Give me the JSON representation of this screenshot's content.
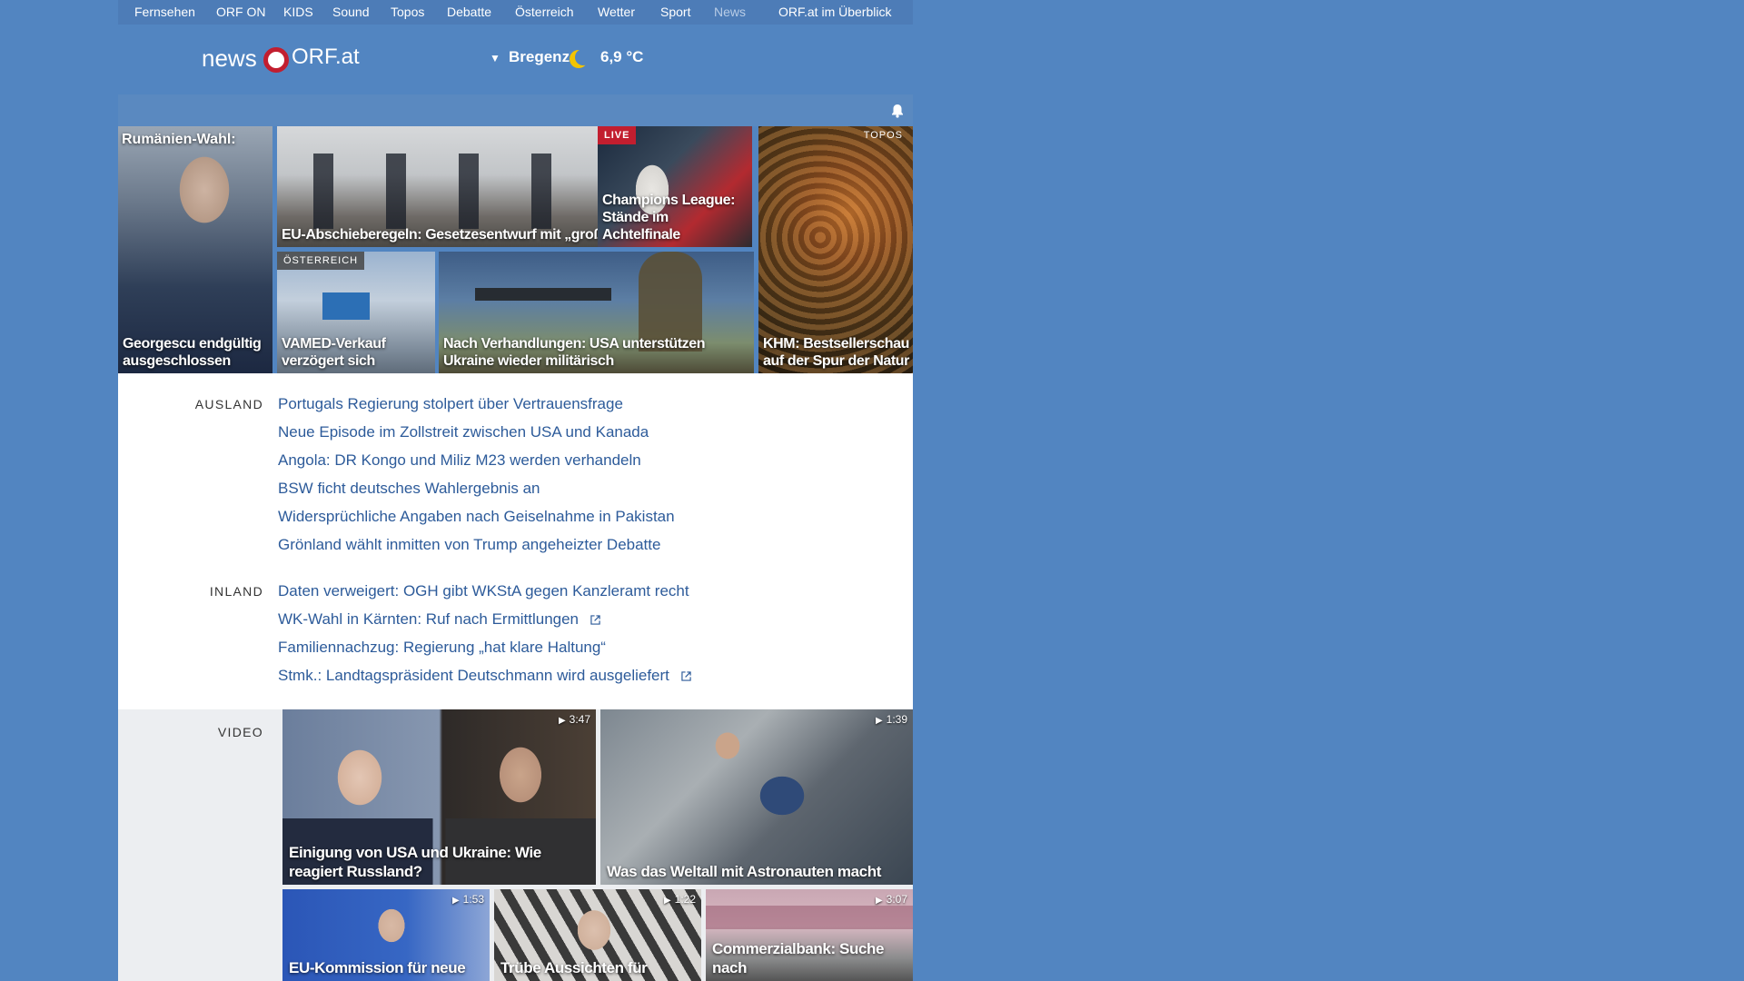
{
  "topnav": {
    "items": [
      "Fernsehen",
      "ORF ON",
      "KIDS",
      "Sound",
      "Topos",
      "Debatte",
      "Österreich",
      "Wetter",
      "Sport",
      "News",
      "ORF.at im Überblick"
    ]
  },
  "header": {
    "logo_news": "news",
    "logo_orf": "ORF.at",
    "weather_city": "Bregenz",
    "weather_temp": "6,9 °C",
    "weather_icon": "moon-icon"
  },
  "tiles": [
    {
      "title": "Rumänien-Wahl:",
      "caption": "Georgescu endgültig ausgeschlossen"
    },
    {
      "caption": "EU-Abschieberegeln: Gesetzesentwurf mit „großer Leerstelle“"
    },
    {
      "badge": "LIVE",
      "caption": "Champions League: Stände im Achtelfinale"
    },
    {
      "badge": "TOPOS",
      "caption": "KHM: Bestsellerschau auf der Spur der Natur"
    },
    {
      "badge": "ÖSTERREICH",
      "caption": "VAMED-Verkauf verzögert sich"
    },
    {
      "caption": "Nach Verhandlungen: USA unterstützen Ukraine wieder militärisch"
    }
  ],
  "sections": {
    "ausland": {
      "label": "AUSLAND",
      "links": [
        "Portugals Regierung stolpert über Vertrauensfrage",
        "Neue Episode im Zollstreit zwischen USA und Kanada",
        "Angola: DR Kongo und Miliz M23 werden verhandeln",
        "BSW ficht deutsches Wahlergebnis an",
        "Widersprüchliche Angaben nach Geiselnahme in Pakistan",
        "Grönland wählt inmitten von Trump angeheizter Debatte"
      ]
    },
    "inland": {
      "label": "INLAND",
      "links": [
        "Daten verweigert: OGH gibt WKStA gegen Kanzleramt recht",
        "WK-Wahl in Kärnten: Ruf nach Ermittlungen",
        "Familiennachzug: Regierung „hat klare Haltung“",
        "Stmk.: Landtagspräsident Deutschmann wird ausgeliefert"
      ]
    }
  },
  "video": {
    "label": "VIDEO",
    "items": [
      {
        "duration": "3:47",
        "caption": "Einigung von USA und Ukraine: Wie reagiert Russland?"
      },
      {
        "duration": "1:39",
        "caption": "Was das Weltall mit Astronauten macht"
      },
      {
        "duration": "1:53",
        "caption": "EU-Kommission für neue"
      },
      {
        "duration": "1:22",
        "caption": "Trübe Aussichten für"
      },
      {
        "duration": "3:07",
        "caption": "Commerzialbank: Suche nach"
      }
    ]
  },
  "colors": {
    "background": "#5285c1",
    "link": "#2d5b9a",
    "live": "#c21e2f"
  }
}
